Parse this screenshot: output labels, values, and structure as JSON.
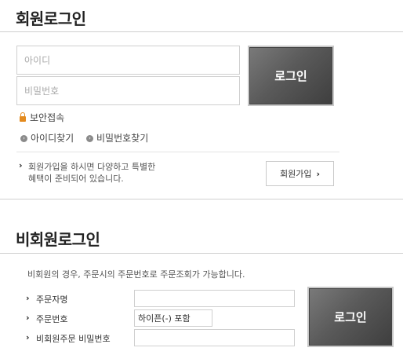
{
  "member_login": {
    "title": "회원로그인",
    "id_placeholder": "아이디",
    "password_placeholder": "비밀번호",
    "login_button": "로그인",
    "secure_access": "보안접속",
    "find_id": "아이디찾기",
    "find_password": "비밀번호찾기",
    "signup_text_line1": "회원가입을 하시면 다양하고 특별한",
    "signup_text_line2": "혜택이 준비되어 있습니다.",
    "signup_button": "회원가입"
  },
  "guest_login": {
    "title": "비회원로그인",
    "description": "비회원의 경우, 주문시의 주문번호로 주문조회가 가능합니다.",
    "orderer_name_label": "주문자명",
    "order_number_label": "주문번호",
    "order_number_value": "하이픈(-) 포함",
    "guest_password_label": "비회원주문 비밀번호",
    "login_button": "로그인"
  },
  "colors": {
    "lock": "#e38a1e",
    "button_dark": "#555555"
  }
}
